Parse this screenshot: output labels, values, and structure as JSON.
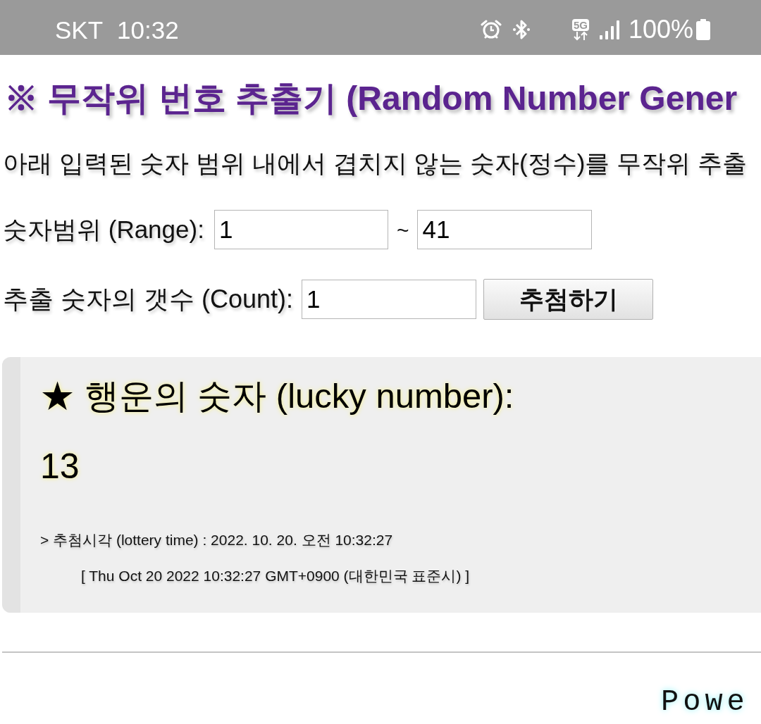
{
  "status_bar": {
    "carrier": "SKT",
    "time": "10:32",
    "network": "5G",
    "battery": "100%"
  },
  "title": "※ 무작위 번호 추출기 (Random Number Gener",
  "description": "아래 입력된 숫자 범위 내에서 겹치지 않는 숫자(정수)를 무작위 추출",
  "range": {
    "label": "숫자범위 (Range):",
    "from": "1",
    "separator": "~",
    "to": "41"
  },
  "count": {
    "label": "추출 숫자의 갯수 (Count):",
    "value": "1",
    "button": "추첨하기"
  },
  "result": {
    "heading": "★ 행운의 숫자 (lucky number):",
    "number": "13",
    "time_line": "> 추첨시각 (lottery time) : 2022. 10. 20. 오전 10:32:27",
    "date_string": "[ Thu Oct 20 2022 10:32:27 GMT+0900 (대한민국 표준시) ]"
  },
  "footer": {
    "text": "Powe"
  }
}
